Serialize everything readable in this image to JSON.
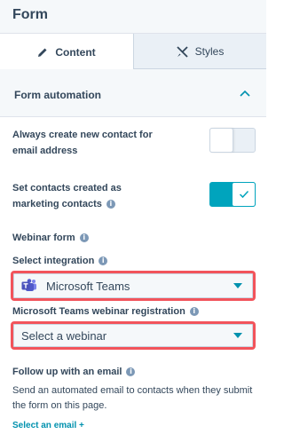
{
  "header": {
    "title": "Form"
  },
  "tabs": [
    {
      "label": "Content",
      "icon": "pencil-icon",
      "active": true
    },
    {
      "label": "Styles",
      "icon": "brush-icon",
      "active": false
    }
  ],
  "section": {
    "title": "Form automation",
    "expanded": true
  },
  "settings": {
    "always_create": {
      "label_line1": "Always create new contact for",
      "label_line2": "email address",
      "enabled": false
    },
    "marketing": {
      "label_line1": "Set contacts created as",
      "label_line2": "marketing contacts",
      "enabled": true
    }
  },
  "webinar": {
    "heading": "Webinar form",
    "integration_label": "Select integration",
    "integration_value": "Microsoft Teams",
    "registration_label": "Microsoft Teams webinar registration",
    "registration_value": "Select a webinar"
  },
  "followup": {
    "heading": "Follow up with an email",
    "description": "Send an automated email to contacts when they submit the form on this page.",
    "link_label": "Select an email",
    "link_plus": "+"
  },
  "colors": {
    "accent": "#00a4bd",
    "highlight": "#f2545b",
    "link": "#0091ae",
    "teams": "#5059c9"
  }
}
